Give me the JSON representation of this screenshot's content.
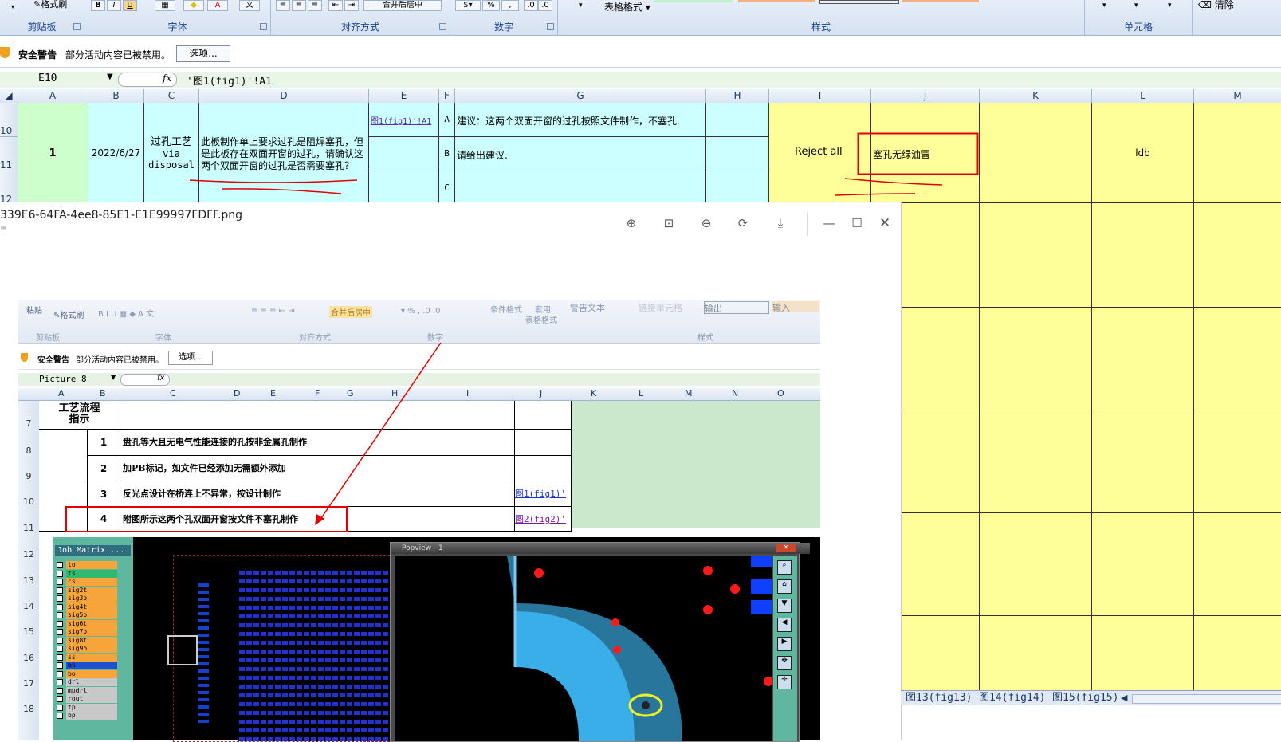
{
  "ribbon": {
    "format_painter": "格式刷",
    "table_format": "表格格式",
    "clear": "清除",
    "groups": [
      "剪贴板",
      "字体",
      "对齐方式",
      "数字",
      "样式",
      "单元格"
    ],
    "merge_center": "合并后居中"
  },
  "security": {
    "title": "安全警告",
    "message": "部分活动内容已被禁用。",
    "options_button": "选项..."
  },
  "formula_bar": {
    "name_box": "E10",
    "fx": "fx",
    "formula": "'图1(fig1)'!A1"
  },
  "columns": [
    "A",
    "B",
    "C",
    "D",
    "E",
    "F",
    "G",
    "H",
    "I",
    "J",
    "K",
    "L",
    "M"
  ],
  "rows": [
    "10",
    "11",
    "12"
  ],
  "row_data": {
    "a": "1",
    "b": "2022/6/27",
    "c_line1": "过孔工艺",
    "c_line2": "via",
    "c_line3": "disposal",
    "d": "此板制作单上要求过孔是阻焊塞孔，但是此板存在双面开窗的过孔，请确认这两个双面开窗的过孔是否需要塞孔？",
    "e_link": "图1(fig1)'!A1",
    "f": [
      "A",
      "B",
      "C"
    ],
    "g": [
      "建议：这两个双面开窗的过孔按照文件制作，不塞孔.",
      "请给出建议."
    ],
    "i": "Reject all",
    "j": "塞孔无绿油冒",
    "l": "ldb"
  },
  "viewer": {
    "filename": "339E6-64FA-4ee8-85E1-E1E99997FDFF.png",
    "icons": [
      "zoom-in-icon",
      "fit-icon",
      "zoom-out-icon",
      "rotate-icon",
      "save-icon"
    ]
  },
  "inner": {
    "paste": "粘贴",
    "format_painter": "格式刷",
    "merge": "合并后居中",
    "cond_format": "条件格式",
    "apply": "套用",
    "table_format": "表格格式",
    "warn_text": "警告文本",
    "link_cell": "链接单元格",
    "output": "输出",
    "input": "输入",
    "groups": [
      "剪贴板",
      "字体",
      "对齐方式",
      "数字",
      "样式"
    ],
    "security_title": "安全警告",
    "security_message": "部分活动内容已被禁用。",
    "options": "选项...",
    "name_box": "Picture 8",
    "fx": "fx",
    "columns": [
      "A",
      "B",
      "C",
      "D",
      "E",
      "F",
      "G",
      "H",
      "I",
      "J",
      "K",
      "L",
      "M",
      "N",
      "O"
    ],
    "header_title_1": "工艺流程",
    "header_title_2": "指示",
    "steps": [
      {
        "row": "8",
        "num": "1",
        "text": "盘孔等大且无电气性能连接的孔按非金属孔制作",
        "link": ""
      },
      {
        "row": "9",
        "num": "2",
        "text": "加PB标记，如文件已经添加无需额外添加",
        "link": ""
      },
      {
        "row": "10",
        "num": "3",
        "text": "反光点设计在桥连上不异常，按设计制作",
        "link": "图1(fig1)'"
      },
      {
        "row": "11",
        "num": "4",
        "text": "附图所示这两个孔双面开窗按文件不塞孔制作",
        "link": "图2(fig2)'"
      }
    ],
    "row_labels": [
      "7",
      "8",
      "9",
      "10",
      "11",
      "12",
      "13",
      "14",
      "15",
      "16",
      "17",
      "18"
    ],
    "job_matrix": "Job Matrix ...",
    "layers": [
      "to",
      "ts",
      "cs",
      "sig2t",
      "sig3b",
      "sig4t",
      "sig5b",
      "sig6t",
      "sig7b",
      "sig8t",
      "sig9b",
      "ss",
      "bs",
      "bo",
      "drl",
      "mpdrl",
      "rout",
      "tp",
      "bp"
    ],
    "popview": "Popview - 1"
  },
  "sheet_tabs": [
    "图13(fig13)",
    "图14(fig14)",
    "图15(fig15)"
  ]
}
